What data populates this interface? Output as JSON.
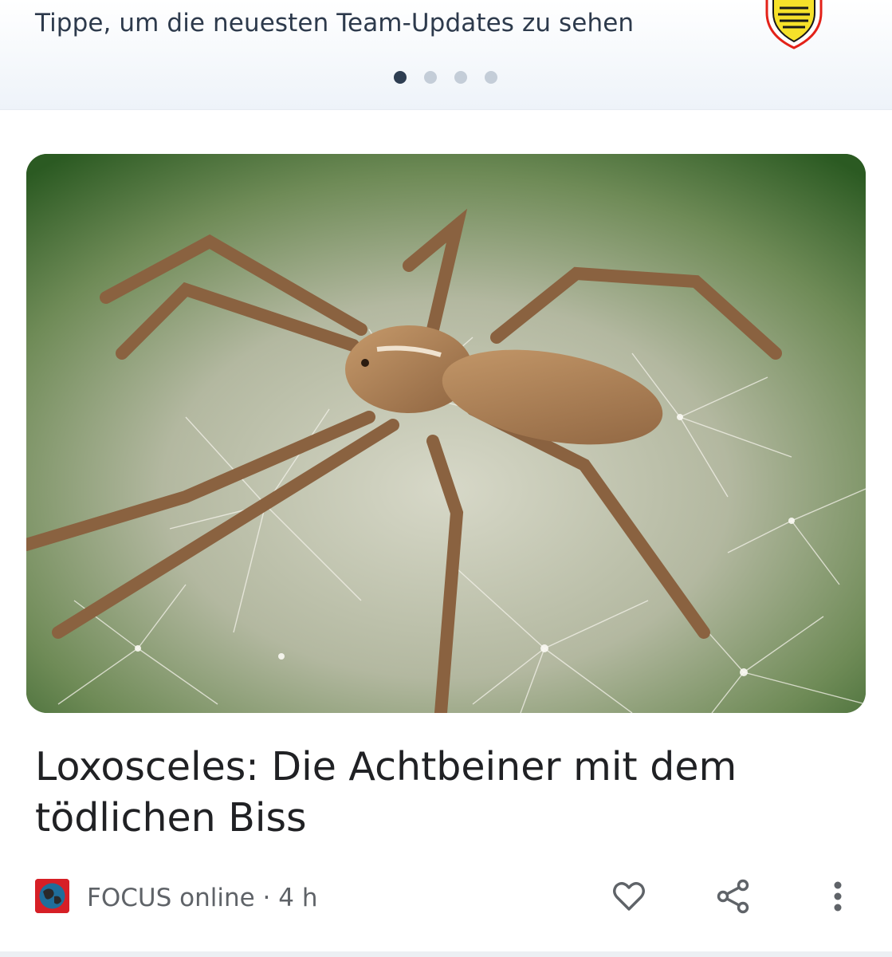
{
  "team_updates": {
    "prompt_text": "Tippe, um die neuesten Team-Updates zu sehen",
    "crest_icon": "vfb-stuttgart-crest-icon",
    "pager": {
      "total": 4,
      "active_index": 0
    }
  },
  "article": {
    "image_alt": "spider-on-dandelion-photo",
    "headline": "Loxosceles: Die Achtbeiner mit dem tödlichen Biss",
    "source": {
      "logo_icon": "focus-online-logo-icon",
      "name": "FOCUS online",
      "separator": "·",
      "age": "4 h"
    },
    "actions": {
      "like_icon": "heart-icon",
      "share_icon": "share-icon",
      "more_icon": "more-vert-icon"
    }
  },
  "colors": {
    "text_primary": "#202124",
    "text_secondary": "#5f6368",
    "card_text": "#2d3a4c",
    "dot_active": "#2e3e52",
    "dot_inactive": "#c4cdd8",
    "focus_red": "#d61f26"
  }
}
